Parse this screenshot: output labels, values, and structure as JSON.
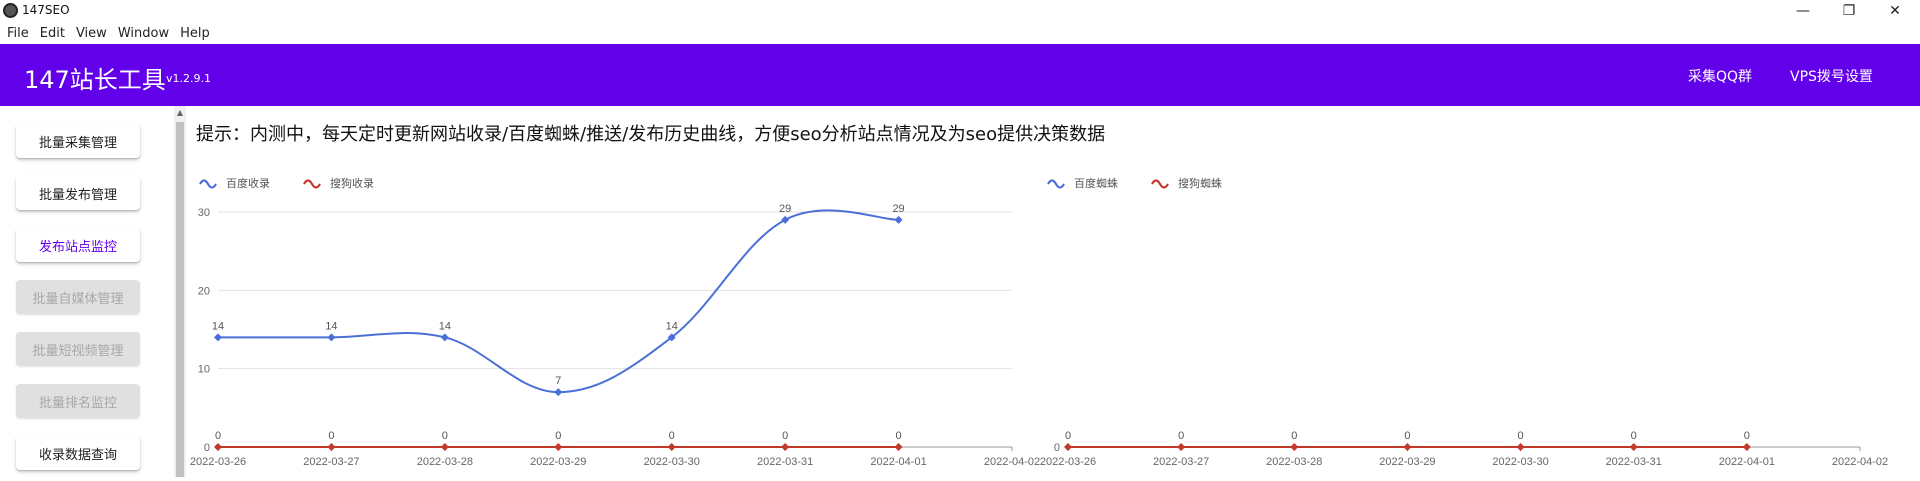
{
  "window": {
    "title": "147SEO",
    "controls": {
      "minimize": "—",
      "restore": "❐",
      "close": "✕"
    }
  },
  "menu": [
    "File",
    "Edit",
    "View",
    "Window",
    "Help"
  ],
  "header": {
    "brand": "147站长工具",
    "version": "v1.2.9.1",
    "buttons": [
      "采集QQ群",
      "VPS拨号设置"
    ],
    "color": "#6200ea"
  },
  "sidebar": {
    "items": [
      {
        "label": "批量采集管理",
        "state": "normal"
      },
      {
        "label": "批量发布管理",
        "state": "normal"
      },
      {
        "label": "发布站点监控",
        "state": "active"
      },
      {
        "label": "批量自媒体管理",
        "state": "disabled"
      },
      {
        "label": "批量短视频管理",
        "state": "disabled"
      },
      {
        "label": "批量排名监控",
        "state": "disabled"
      },
      {
        "label": "收录数据查询",
        "state": "normal"
      }
    ]
  },
  "notice": "提示：内测中，每天定时更新网站收录/百度蜘蛛/推送/发布历史曲线，方便seo分析站点情况及为seo提供决策数据",
  "chart_data": [
    {
      "type": "line",
      "categories": [
        "2022-03-26",
        "2022-03-27",
        "2022-03-28",
        "2022-03-29",
        "2022-03-30",
        "2022-03-31",
        "2022-04-01",
        "2022-04-02"
      ],
      "series": [
        {
          "name": "百度收录",
          "values": [
            14,
            14,
            14,
            7,
            14,
            29,
            29,
            null
          ],
          "color": "#4a6fd8"
        },
        {
          "name": "搜狗收录",
          "values": [
            0,
            0,
            0,
            0,
            0,
            0,
            0,
            null
          ],
          "color": "#c0392b"
        }
      ],
      "yticks": [
        0,
        10,
        20,
        30
      ],
      "ylim": [
        0,
        30
      ],
      "grid": true,
      "legend": "top-left",
      "smooth": true
    },
    {
      "type": "line",
      "categories": [
        "2022-03-26",
        "2022-03-27",
        "2022-03-28",
        "2022-03-29",
        "2022-03-30",
        "2022-03-31",
        "2022-04-01",
        "2022-04-02"
      ],
      "series": [
        {
          "name": "百度蜘蛛",
          "values": [
            null,
            null,
            null,
            null,
            null,
            null,
            null,
            null
          ],
          "color": "#4a6fd8"
        },
        {
          "name": "搜狗蜘蛛",
          "values": [
            0,
            0,
            0,
            0,
            0,
            0,
            0,
            null
          ],
          "color": "#c0392b"
        }
      ],
      "yticks": [
        0
      ],
      "ylim": [
        0,
        30
      ],
      "grid": false,
      "legend": "top-left",
      "smooth": true
    }
  ]
}
